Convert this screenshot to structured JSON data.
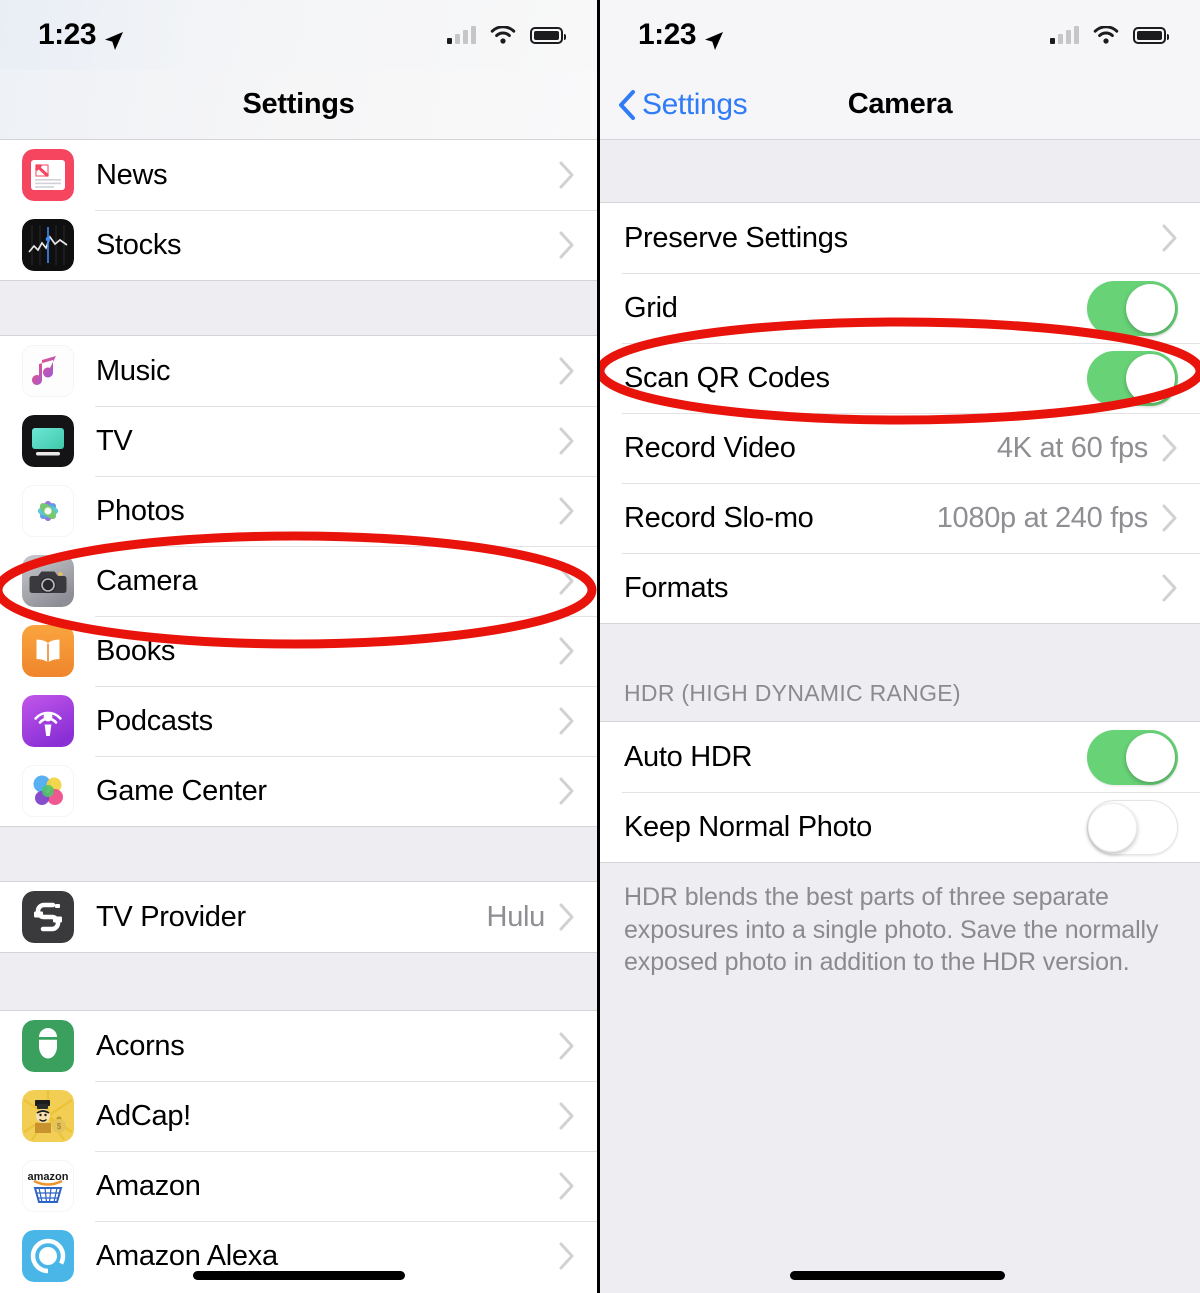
{
  "left_screen": {
    "status_bar": {
      "time": "1:23",
      "location_icon": "location-arrow-icon",
      "signal_icon": "cellular-signal-icon",
      "wifi_icon": "wifi-icon",
      "battery_icon": "battery-full-icon"
    },
    "nav": {
      "title": "Settings"
    },
    "sections": [
      {
        "rows": [
          {
            "icon": "news-app-icon",
            "label": "News",
            "value": "",
            "accessory": "chevron-right-icon"
          },
          {
            "icon": "stocks-app-icon",
            "label": "Stocks",
            "value": "",
            "accessory": "chevron-right-icon"
          }
        ]
      },
      {
        "rows": [
          {
            "icon": "music-app-icon",
            "label": "Music",
            "value": "",
            "accessory": "chevron-right-icon"
          },
          {
            "icon": "tv-app-icon",
            "label": "TV",
            "value": "",
            "accessory": "chevron-right-icon"
          },
          {
            "icon": "photos-app-icon",
            "label": "Photos",
            "value": "",
            "accessory": "chevron-right-icon"
          },
          {
            "icon": "camera-app-icon",
            "label": "Camera",
            "value": "",
            "accessory": "chevron-right-icon"
          },
          {
            "icon": "books-app-icon",
            "label": "Books",
            "value": "",
            "accessory": "chevron-right-icon"
          },
          {
            "icon": "podcasts-app-icon",
            "label": "Podcasts",
            "value": "",
            "accessory": "chevron-right-icon"
          },
          {
            "icon": "game-center-app-icon",
            "label": "Game Center",
            "value": "",
            "accessory": "chevron-right-icon"
          }
        ]
      },
      {
        "rows": [
          {
            "icon": "tv-provider-icon",
            "label": "TV Provider",
            "value": "Hulu",
            "accessory": "chevron-right-icon"
          }
        ]
      },
      {
        "rows": [
          {
            "icon": "acorns-app-icon",
            "label": "Acorns",
            "value": "",
            "accessory": "chevron-right-icon"
          },
          {
            "icon": "adcap-app-icon",
            "label": "AdCap!",
            "value": "",
            "accessory": "chevron-right-icon"
          },
          {
            "icon": "amazon-app-icon",
            "label": "Amazon",
            "value": "",
            "accessory": "chevron-right-icon"
          },
          {
            "icon": "amazon-alexa-app-icon",
            "label": "Amazon Alexa",
            "value": "",
            "accessory": "chevron-right-icon"
          }
        ]
      }
    ],
    "annotation": {
      "shape": "ellipse",
      "target": "Camera",
      "color": "#e8140c"
    }
  },
  "right_screen": {
    "status_bar": {
      "time": "1:23",
      "location_icon": "location-arrow-icon",
      "signal_icon": "cellular-signal-icon",
      "wifi_icon": "wifi-icon",
      "battery_icon": "battery-full-icon"
    },
    "nav": {
      "back_label": "Settings",
      "title": "Camera"
    },
    "sections": [
      {
        "header": "",
        "footer": "",
        "rows": [
          {
            "label": "Preserve Settings",
            "type": "disclosure",
            "value": "",
            "accessory": "chevron-right-icon"
          },
          {
            "label": "Grid",
            "type": "toggle",
            "toggle_state": "on"
          },
          {
            "label": "Scan QR Codes",
            "type": "toggle",
            "toggle_state": "on"
          },
          {
            "label": "Record Video",
            "type": "disclosure",
            "value": "4K at 60 fps",
            "accessory": "chevron-right-icon"
          },
          {
            "label": "Record Slo-mo",
            "type": "disclosure",
            "value": "1080p at 240 fps",
            "accessory": "chevron-right-icon"
          },
          {
            "label": "Formats",
            "type": "disclosure",
            "value": "",
            "accessory": "chevron-right-icon"
          }
        ]
      },
      {
        "header": "HDR (HIGH DYNAMIC RANGE)",
        "footer": "HDR blends the best parts of three separate exposures into a single photo. Save the normally exposed photo in addition to the HDR version.",
        "rows": [
          {
            "label": "Auto HDR",
            "type": "toggle",
            "toggle_state": "on"
          },
          {
            "label": "Keep Normal Photo",
            "type": "toggle",
            "toggle_state": "off"
          }
        ]
      }
    ],
    "annotation": {
      "shape": "ellipse",
      "target": "Scan QR Codes",
      "color": "#e8140c"
    }
  },
  "colors": {
    "accent_blue": "#2f7cf6",
    "toggle_on_green": "#68d277",
    "group_background": "#eeeef2",
    "row_background": "#ffffff",
    "secondary_text": "#8e8e93",
    "annotation_red": "#e8140c"
  }
}
